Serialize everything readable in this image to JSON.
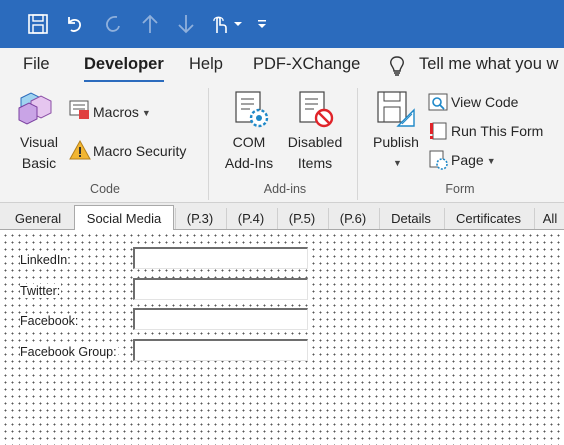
{
  "quick_access": {
    "icons": [
      "save-icon",
      "undo-icon",
      "redo-icon",
      "move-up-icon",
      "move-down-icon",
      "touch-mode-icon",
      "dropdown-icon",
      "customize-icon"
    ]
  },
  "menu": {
    "items": [
      "File",
      "Developer",
      "Help",
      "PDF-XChange"
    ],
    "active": "Developer",
    "tell_me": "Tell me what you w"
  },
  "ribbon": {
    "code": {
      "visual_basic": [
        "Visual",
        "Basic"
      ],
      "macros": "Macros",
      "macro_security": "Macro Security",
      "label": "Code"
    },
    "addins": {
      "com": [
        "COM",
        "Add-Ins"
      ],
      "disabled": [
        "Disabled",
        "Items"
      ],
      "label": "Add-ins"
    },
    "form": {
      "publish": "Publish",
      "view_code": "View Code",
      "run_this_form": "Run This Form",
      "page": "Page",
      "label": "Form"
    }
  },
  "tabs": [
    "General",
    "Social Media",
    "(P.3)",
    "(P.4)",
    "(P.5)",
    "(P.6)",
    "Details",
    "Certificates",
    "All"
  ],
  "active_tab": "Social Media",
  "fields": [
    {
      "label": "LinkedIn:",
      "value": ""
    },
    {
      "label": "Twitter:",
      "value": ""
    },
    {
      "label": "Facebook:",
      "value": ""
    },
    {
      "label": "Facebook Group:",
      "value": ""
    }
  ],
  "colors": {
    "title_bar": "#2b6bbd",
    "ribbon": "#f3f3f3"
  }
}
